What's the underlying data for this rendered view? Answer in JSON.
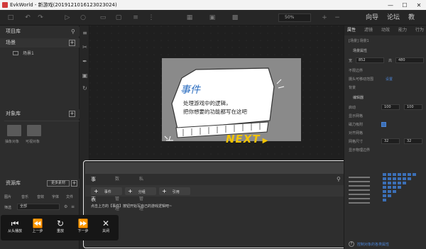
{
  "window": {
    "title": "EvkWorld - 新游戏(20191210161230​23024)"
  },
  "toolbar": {
    "zoom": "50%",
    "nav": [
      "向导",
      "论坛",
      "教"
    ]
  },
  "left": {
    "project": "项目库",
    "scenes": "场景",
    "scene1": "场景1",
    "objects": "对象库",
    "folders": [
      "抽象对象",
      "可视对象"
    ],
    "resources": "资源库",
    "more_materials": "更多素材",
    "res_tabs": [
      "图片",
      "音乐",
      "音效",
      "字体",
      "文件"
    ],
    "filter_label": "筛选",
    "filter_value": "全部"
  },
  "dialog": {
    "tabs": [
      "事件表",
      "数据管理",
      "私图管理"
    ],
    "buttons": [
      "事件",
      "分组",
      "引用"
    ],
    "hint": "点击上方的【事件】按钮开始写自己的游戏逻辑吧~"
  },
  "stage": {
    "bubble_title": "事件",
    "line1": "处理游戏中的逻辑，",
    "line2": "把你想要的功能都写在这吧",
    "next": "NEXT"
  },
  "playback": {
    "buttons": [
      "从头播放",
      "上一步",
      "重放",
      "下一步",
      "关闭"
    ]
  },
  "right": {
    "tabs": [
      "属性",
      "滤镜",
      "动效",
      "能力",
      "行为"
    ],
    "object_name": "[场景] 场景1",
    "section_scene": "场景属性",
    "width_label": "宽",
    "width": "852",
    "height_label": "高",
    "height": "480",
    "rows": [
      "不限边界",
      "摄头可移动范围",
      "背景"
    ],
    "set_link": "设置",
    "section_editor": "编辑器",
    "editor_rows": [
      "启动",
      "显示网格",
      "磁力吸附",
      "对齐网格",
      "网格尺寸",
      "显示物理边界"
    ],
    "start_value": "100",
    "start_value2": "100",
    "grid_w": "32",
    "grid_h": "32",
    "help_link": "控制对象的各类属性"
  },
  "colors": {
    "accent": "#3b6fb6",
    "next": "#f2c300",
    "canvas": "#1f1f1f",
    "stage": "#8a8a8a"
  }
}
